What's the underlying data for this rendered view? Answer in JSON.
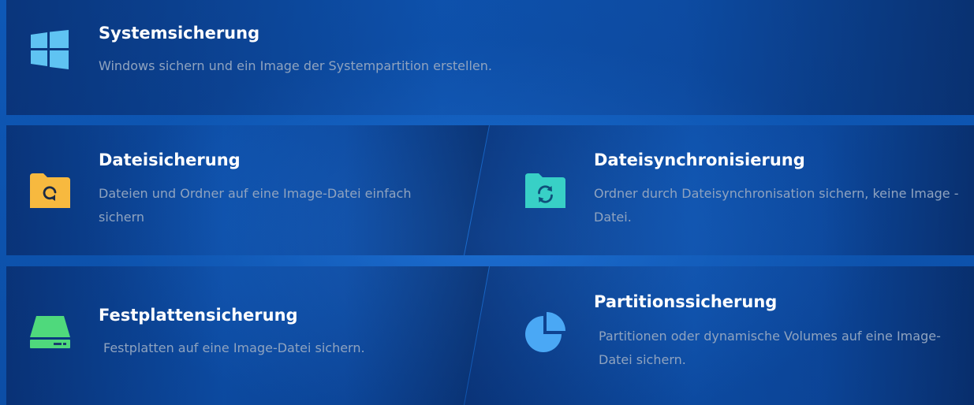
{
  "cards": {
    "system_backup": {
      "title": "Systemsicherung",
      "description": "Windows sichern und ein Image der Systempartition erstellen.",
      "icon": "windows-icon",
      "icon_color": "#5fc3f2"
    },
    "file_backup": {
      "title": "Dateisicherung",
      "description": "Dateien und Ordner auf eine Image-Datei einfach sichern",
      "icon": "folder-backup-icon",
      "icon_color": "#f7b93f"
    },
    "file_sync": {
      "title": "Dateisynchronisierung",
      "description": "Ordner durch Dateisynchronisation sichern, keine Image -Datei.",
      "icon": "folder-sync-icon",
      "icon_color": "#38d0c6"
    },
    "disk_backup": {
      "title": "Festplattensicherung",
      "description": "Festplatten auf eine Image-Datei sichern.",
      "icon": "hard-disk-icon",
      "icon_color": "#4fd97c"
    },
    "partition_backup": {
      "title": "Partitionssicherung",
      "description": "Partitionen oder dynamische Volumes auf eine Image-Datei sichern.",
      "icon": "partition-pie-icon",
      "icon_color": "#4aa8f5"
    }
  }
}
